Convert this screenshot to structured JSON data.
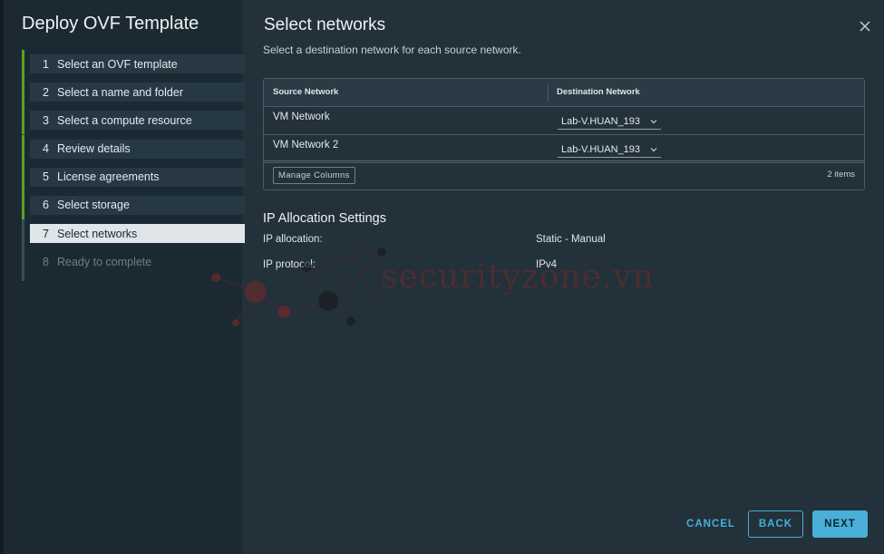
{
  "wizard": {
    "title": "Deploy OVF Template",
    "steps": [
      {
        "num": "1",
        "label": "Select an OVF template"
      },
      {
        "num": "2",
        "label": "Select a name and folder"
      },
      {
        "num": "3",
        "label": "Select a compute resource"
      },
      {
        "num": "4",
        "label": "Review details"
      },
      {
        "num": "5",
        "label": "License agreements"
      },
      {
        "num": "6",
        "label": "Select storage"
      },
      {
        "num": "7",
        "label": "Select networks"
      },
      {
        "num": "8",
        "label": "Ready to complete"
      }
    ],
    "active_step": 7
  },
  "page": {
    "title": "Select networks",
    "subtitle": "Select a destination network for each source network."
  },
  "grid": {
    "columns": [
      "Source Network",
      "Destination Network"
    ],
    "rows": [
      {
        "source": "VM Network",
        "destination": "Lab-V.HUAN_193"
      },
      {
        "source": "VM Network 2",
        "destination": "Lab-V.HUAN_193"
      }
    ],
    "manage_columns_label": "Manage Columns",
    "items_count": "2 items"
  },
  "ip_allocation": {
    "title": "IP Allocation Settings",
    "ip_allocation_label": "IP allocation:",
    "ip_allocation_value": "Static - Manual",
    "ip_protocol_label": "IP protocol:",
    "ip_protocol_value": "IPv4"
  },
  "watermark": {
    "text": "securityzone.vn"
  },
  "footer": {
    "cancel_label": "CANCEL",
    "back_label": "BACK",
    "next_label": "NEXT"
  },
  "colors": {
    "accent": "#49afd9",
    "step_complete": "#5aa220",
    "background": "#22313a",
    "sidebar": "#1b2a32"
  },
  "icons": {
    "close": "close-icon",
    "dropdown": "chevron-down-icon"
  }
}
